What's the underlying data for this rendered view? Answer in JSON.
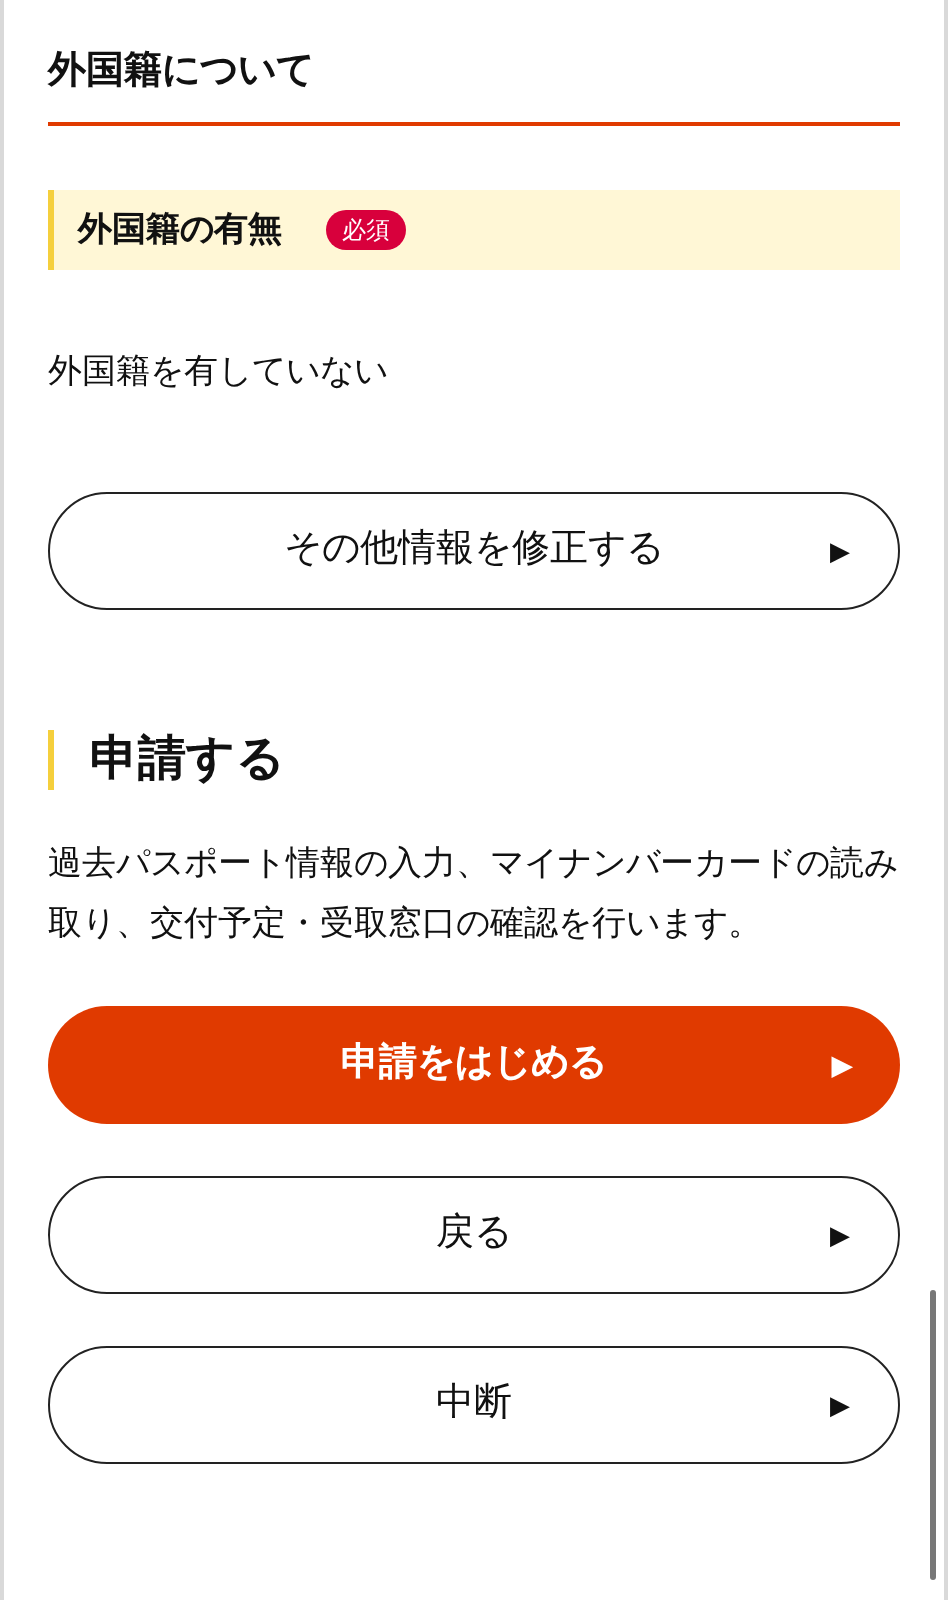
{
  "section": {
    "title": "外国籍について"
  },
  "field": {
    "label": "外国籍の有無",
    "badge": "必須",
    "value": "外国籍を有していない"
  },
  "edit_button": {
    "label": "その他情報を修正する",
    "arrow": "▶"
  },
  "apply": {
    "title": "申請する",
    "description": "過去パスポート情報の入力、マイナンバーカードの読み取り、交付予定・受取窓口の確認を行います。"
  },
  "buttons": [
    {
      "kind": "primary",
      "label": "申請をはじめる",
      "arrow": "▶"
    },
    {
      "kind": "secondary",
      "label": "戻る",
      "arrow": "▶"
    },
    {
      "kind": "secondary",
      "label": "中断",
      "arrow": "▶"
    }
  ]
}
